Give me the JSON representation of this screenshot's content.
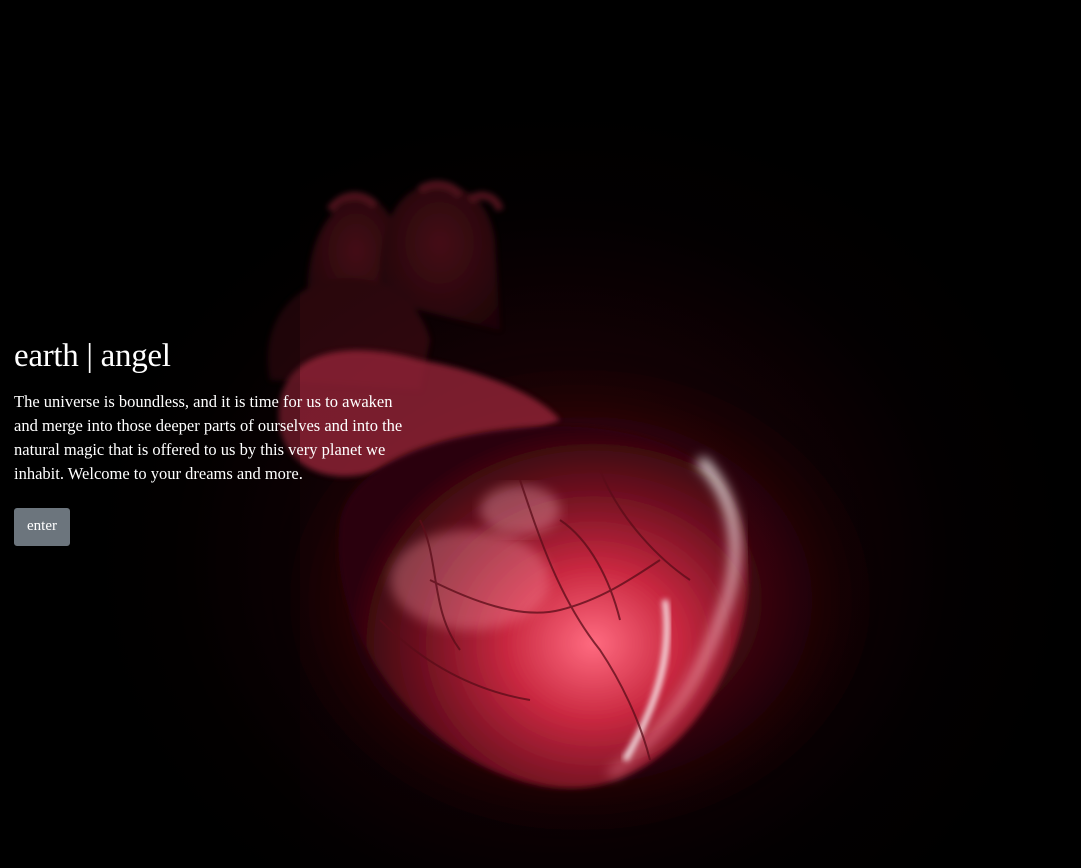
{
  "hero": {
    "title": "earth | angel",
    "description": "The universe is boundless, and it is time for us to awaken and merge into those deeper parts of ourselves and into the natural magic that is offered to us by this very planet we inhabit. Welcome to your dreams and more.",
    "enter_label": "enter"
  },
  "background": {
    "image_subject": "glowing-anatomical-heart",
    "base_color": "#000000",
    "heart_color": "#e8344f",
    "glow_color": "#ff5a70"
  },
  "button": {
    "background_color": "#6c757d",
    "text_color": "#ffffff"
  }
}
